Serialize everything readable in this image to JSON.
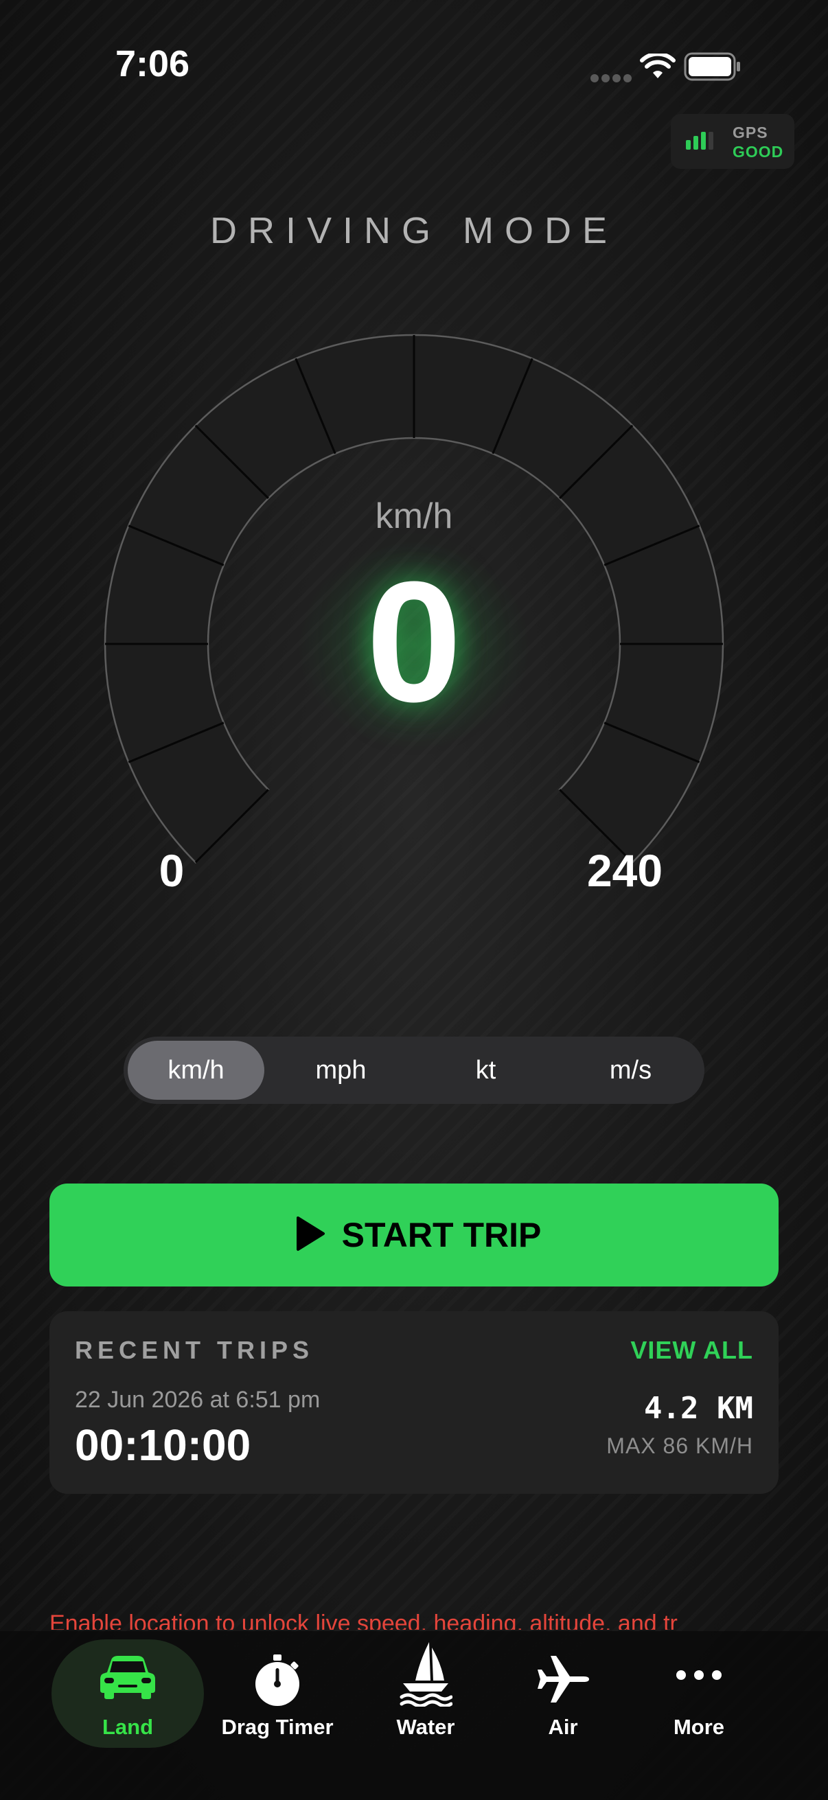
{
  "status_bar": {
    "time": "7:06"
  },
  "gps": {
    "label": "GPS",
    "status": "GOOD",
    "color": "#30d158"
  },
  "mode_title": "DRIVING MODE",
  "gauge": {
    "unit": "km/h",
    "speed": "0",
    "min": "0",
    "max": "240",
    "glow_color": "#30d158"
  },
  "units": {
    "options": [
      "km/h",
      "mph",
      "kt",
      "m/s"
    ],
    "selected": "km/h"
  },
  "start_trip": {
    "label": "START TRIP",
    "icon": "play-icon"
  },
  "recent_trips": {
    "title": "RECENT TRIPS",
    "view_all": "VIEW ALL",
    "trip": {
      "date": "22 Jun 2026 at 6:51 pm",
      "duration": "00:10:00",
      "distance": "4.2 KM",
      "max_speed": "MAX 86 KM/H"
    }
  },
  "location_warning": "Enable location to unlock live speed, heading, altitude, and tr",
  "tabs": [
    {
      "label": "Land",
      "icon": "car-icon",
      "active": true
    },
    {
      "label": "Drag Timer",
      "icon": "stopwatch-icon",
      "active": false
    },
    {
      "label": "Water",
      "icon": "sailboat-icon",
      "active": false
    },
    {
      "label": "Air",
      "icon": "airplane-icon",
      "active": false
    },
    {
      "label": "More",
      "icon": "ellipsis-icon",
      "active": false
    }
  ],
  "colors": {
    "accent": "#30d158",
    "active_tab": "#36e348",
    "warning": "#e5453b",
    "background": "#111111"
  }
}
